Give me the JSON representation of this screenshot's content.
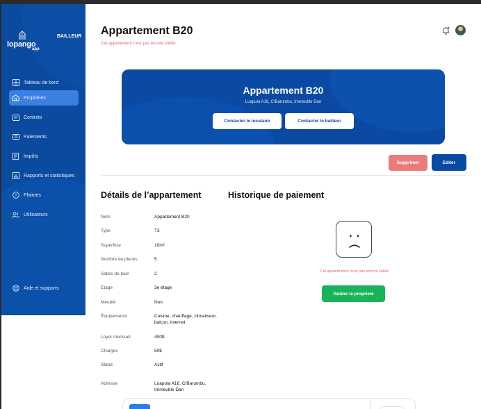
{
  "app": {
    "logo_text": "lopango",
    "logo_sub": "app",
    "role": "BAILLEUR"
  },
  "sidebar": {
    "items": [
      {
        "label": "Tableau de bord",
        "icon": "dashboard-icon"
      },
      {
        "label": "Propriétés",
        "icon": "property-icon",
        "active": true
      },
      {
        "label": "Contrats",
        "icon": "contract-icon"
      },
      {
        "label": "Paiements",
        "icon": "payment-icon"
      },
      {
        "label": "Impôts",
        "icon": "tax-icon"
      },
      {
        "label": "Rapports et statistiques",
        "icon": "chart-icon"
      },
      {
        "label": "Plaintes",
        "icon": "complaint-icon"
      },
      {
        "label": "Utilisateurs",
        "icon": "users-icon"
      }
    ],
    "help": {
      "label": "Aide et supports",
      "icon": "help-icon"
    }
  },
  "header": {
    "title": "Appartement B20",
    "subtitle": "Cet appartement n'est pas encore validé"
  },
  "banner": {
    "title": "Appartement B20",
    "address": "Luapula A16, C/Barumbu, Immeuble Dan",
    "contact_tenant": "Contacter le locataire",
    "contact_owner": "Contacter le bailleur"
  },
  "actions": {
    "delete": "Supprimer",
    "edit": "Editer"
  },
  "details": {
    "title": "Détails de l’appartement",
    "rows": [
      {
        "label": "Nom",
        "value": "Appartement B20"
      },
      {
        "label": "Type",
        "value": "T3"
      },
      {
        "label": "Superficie",
        "value": "10m²"
      },
      {
        "label": "Nombre de pieces",
        "value": "5"
      },
      {
        "label": "Salles de bain",
        "value": "2"
      },
      {
        "label": "Etage",
        "value": "3e étage"
      },
      {
        "label": "Meublé",
        "value": "Non"
      },
      {
        "label": "Équipements",
        "value": "Cuisine, chauffage, climatiseur, balcon, internet"
      },
      {
        "label": "Loyer mensuel",
        "value": "400$"
      },
      {
        "label": "Charges",
        "value": "50$"
      },
      {
        "label": "Statut",
        "value": "Actif"
      },
      {
        "label": "Adresse",
        "value": "Luapula A16, C/Barumbu, Immeuble Dan"
      }
    ]
  },
  "payments": {
    "title": "Historique de paiement",
    "empty_message": "Cet appartement n'est pas encore validé",
    "validate_button": "Valider la propriete"
  },
  "colors": {
    "primary": "#0b4aa3",
    "sidebar": "#0a4ba0",
    "active_item": "#3b7fe0",
    "danger": "#ea7b7d",
    "success": "#19b35a",
    "warning_text": "#e06666"
  }
}
